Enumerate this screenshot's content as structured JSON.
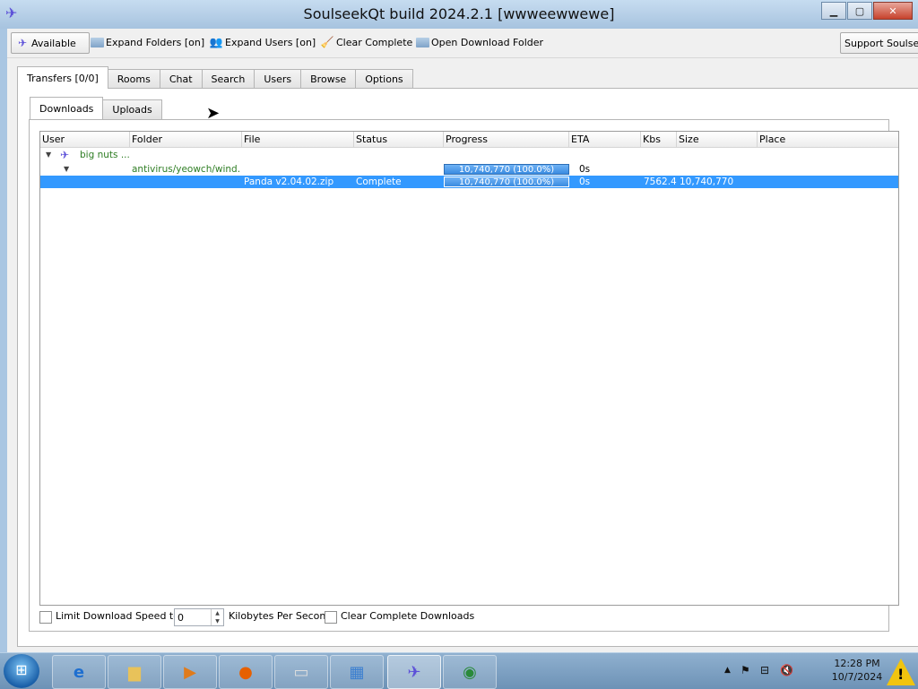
{
  "window": {
    "title": "SoulseekQt build 2024.2.1 [wwweewwewe]"
  },
  "toolbar": {
    "available_label": "Available",
    "expand_folders_label": "Expand Folders [on]",
    "expand_users_label": "Expand Users [on]",
    "clear_complete_label": "Clear Complete",
    "open_download_folder_label": "Open Download Folder",
    "support_label": "Support Soulseek"
  },
  "tabs": [
    "Transfers [0/0]",
    "Rooms",
    "Chat",
    "Search",
    "Users",
    "Browse",
    "Options"
  ],
  "subtabs": [
    "Downloads",
    "Uploads"
  ],
  "table": {
    "columns": [
      "User",
      "Folder",
      "File",
      "Status",
      "Progress",
      "ETA",
      "Kbs",
      "Size",
      "Place"
    ],
    "user_row": {
      "user": "big nuts ..."
    },
    "folder_row": {
      "folder": "antivirus/yeowch/wind...",
      "progress": "10,740,770 (100.0%)",
      "eta": "0s"
    },
    "file_row": {
      "file": "Panda v2.04.02.zip",
      "status": "Complete",
      "progress": "10,740,770 (100.0%)",
      "eta": "0s",
      "kbs": "7562.4",
      "size": "10,740,770"
    }
  },
  "bottom": {
    "limit_label": "Limit Download Speed to",
    "limit_value": "0",
    "kbps_label": "Kilobytes Per Second",
    "clear_label": "Clear Complete Downloads"
  },
  "taskbar": {
    "time": "12:28 PM",
    "date": "10/7/2024"
  }
}
